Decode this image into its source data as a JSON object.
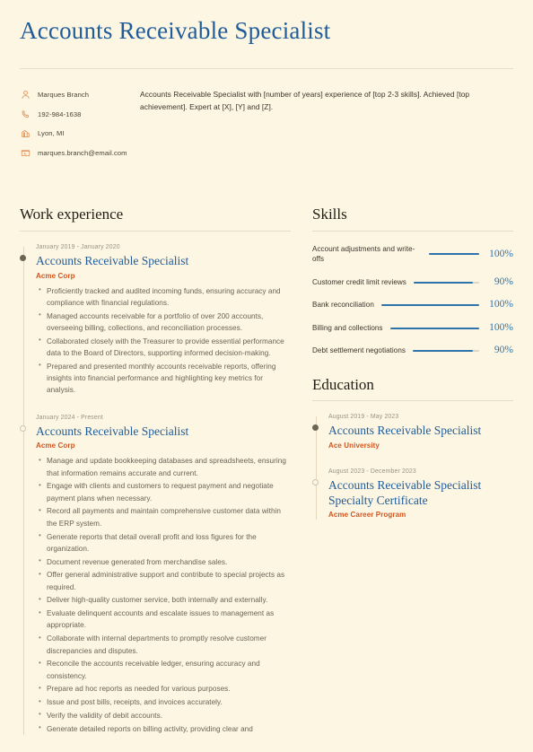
{
  "document": {
    "title": "Accounts Receivable Specialist",
    "background_color": "#fdf6e3",
    "accent_blue": "#1f5c99",
    "accent_orange": "#d4541e"
  },
  "contact": {
    "items": [
      {
        "icon": "person-icon",
        "value": "Marques Branch"
      },
      {
        "icon": "phone-icon",
        "value": "192-984-1638"
      },
      {
        "icon": "building-icon",
        "value": "Lyon, MI"
      },
      {
        "icon": "email-icon",
        "value": "marques.branch@email.com"
      }
    ]
  },
  "summary": {
    "text": "Accounts Receivable Specialist with [number of years] experience of [top 2-3 skills]. Achieved [top achievement]. Expert at [X], [Y] and [Z]."
  },
  "work_experience": {
    "heading": "Work experience",
    "entries": [
      {
        "date": "January 2019 - January 2020",
        "title": "Accounts Receivable Specialist",
        "organization": "Acme Corp",
        "marker": "filled",
        "points": [
          "Proficiently tracked and audited incoming funds, ensuring accuracy and compliance with financial regulations.",
          "Managed accounts receivable for a portfolio of over 200 accounts, overseeing billing, collections, and reconciliation processes.",
          "Collaborated closely with the Treasurer to provide essential performance data to the Board of Directors, supporting informed decision-making.",
          "Prepared and presented monthly accounts receivable reports, offering insights into financial performance and highlighting key metrics for analysis."
        ]
      },
      {
        "date": "January 2024 - Present",
        "title": "Accounts Receivable Specialist",
        "organization": "Acme Corp",
        "marker": "hollow",
        "points": [
          "Manage and update bookkeeping databases and spreadsheets, ensuring that information remains accurate and current.",
          "Engage with clients and customers to request payment and negotiate payment plans when necessary.",
          "Record all payments and maintain comprehensive customer data within the ERP system.",
          "Generate reports that detail overall profit and loss figures for the organization.",
          "Document revenue generated from merchandise sales.",
          "Offer general administrative support and contribute to special projects as required.",
          "Deliver high-quality customer service, both internally and externally.",
          "Evaluate delinquent accounts and escalate issues to management as appropriate.",
          "Collaborate with internal departments to promptly resolve customer discrepancies and disputes.",
          "Reconcile the accounts receivable ledger, ensuring accuracy and consistency.",
          "Prepare ad hoc reports as needed for various purposes.",
          "Issue and post bills, receipts, and invoices accurately.",
          "Verify the validity of debit accounts.",
          "Generate detailed reports on billing activity, providing clear and"
        ]
      }
    ]
  },
  "skills": {
    "heading": "Skills",
    "items": [
      {
        "name": "Account adjustments and write-offs",
        "percent_label": "100%",
        "percent": 100
      },
      {
        "name": "Customer credit limit reviews",
        "percent_label": "90%",
        "percent": 90
      },
      {
        "name": "Bank reconciliation",
        "percent_label": "100%",
        "percent": 100
      },
      {
        "name": "Billing and collections",
        "percent_label": "100%",
        "percent": 100
      },
      {
        "name": "Debt settlement negotiations",
        "percent_label": "90%",
        "percent": 90
      }
    ]
  },
  "education": {
    "heading": "Education",
    "entries": [
      {
        "date": "August 2019 - May 2023",
        "title": "Accounts Receivable Specialist",
        "organization": "Ace University",
        "marker": "filled"
      },
      {
        "date": "August 2023 - December 2023",
        "title": "Accounts Receivable Specialist Specialty Certificate",
        "organization": "Acme Career Program",
        "marker": "hollow"
      }
    ]
  }
}
